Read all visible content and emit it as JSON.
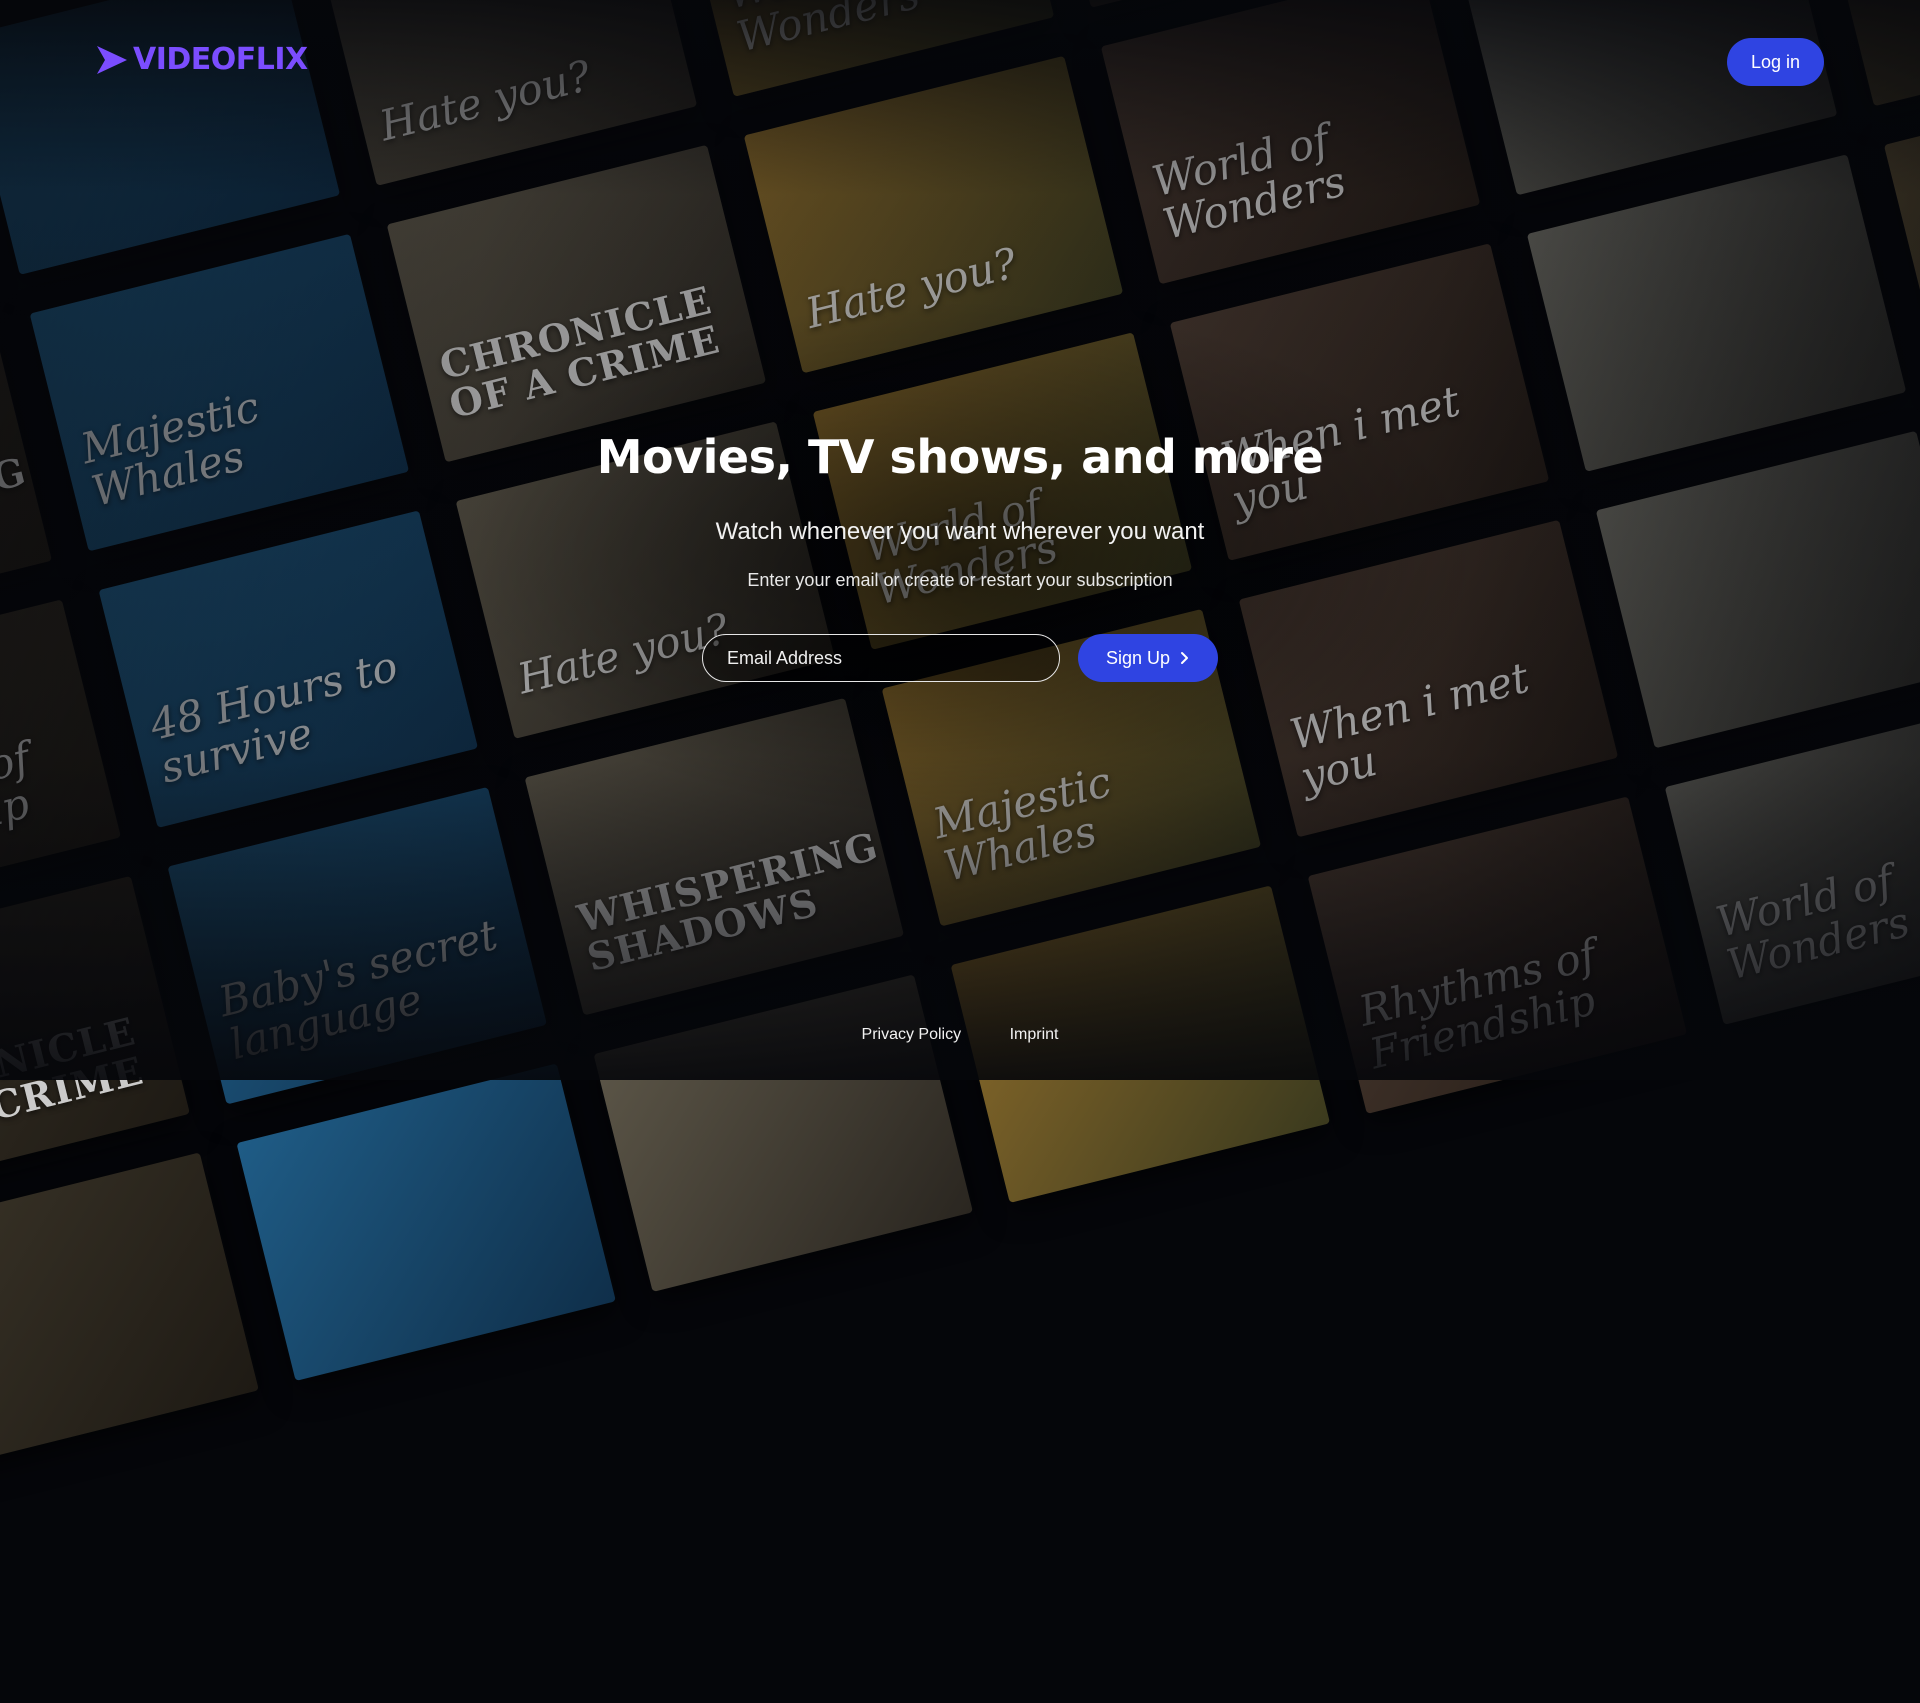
{
  "brand": {
    "name": "VIDEOFLIX",
    "color": "#7b4dff"
  },
  "header": {
    "login_label": "Log in"
  },
  "hero": {
    "title": "Movies, TV shows, and more",
    "subtitle": "Watch whenever you want wherever you want",
    "prompt": "Enter your email or create or restart your subscription"
  },
  "signup_form": {
    "email_placeholder": "Email Address",
    "button_label": "Sign Up",
    "button_icon": "chevron-right-icon"
  },
  "footer": {
    "privacy_label": "Privacy Policy",
    "imprint_label": "Imprint"
  },
  "colors": {
    "accent": "#2f44e2",
    "background": "#05060a"
  },
  "background_titles": [
    "When i met you",
    "",
    "Hate you?",
    "World of Wonders",
    "",
    "Chronicle of a CRIME",
    "",
    "Whispering SHADOWS",
    "Majestic Whales",
    "Chronicle of a CRIME",
    "Hate you?",
    "World of Wonders",
    "",
    "",
    "Rhythms of Friendship",
    "48 Hours to survive",
    "Hate you?",
    "World of Wonders",
    "When i met you",
    "",
    "",
    "Chronicle of a CRIME",
    "Baby's secret language",
    "Whispering SHADOWS",
    "Majestic Whales",
    "When i met you",
    "",
    "",
    "",
    "",
    "",
    "",
    "Rhythms of Friendship",
    "World of Wonders",
    ""
  ]
}
